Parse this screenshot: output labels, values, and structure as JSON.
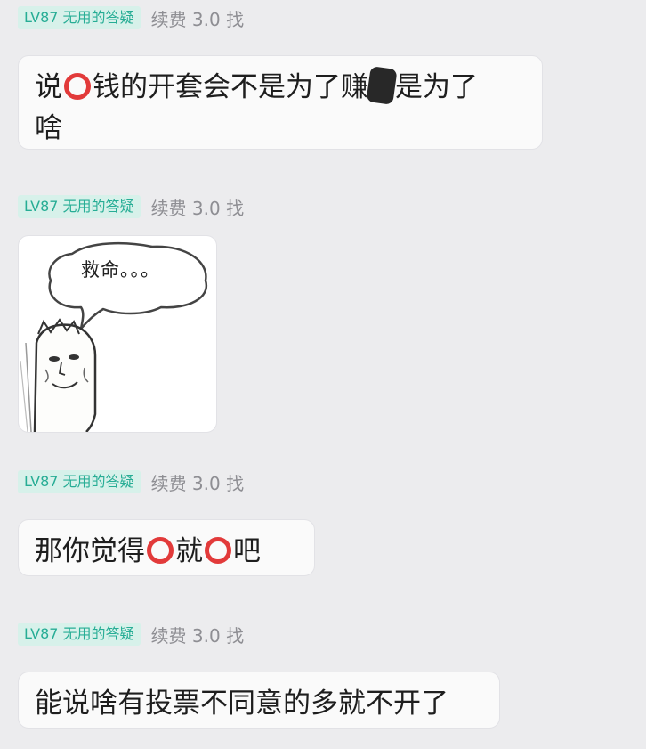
{
  "messages": [
    {
      "badge": "LV87 无用的答疑",
      "nick": "续费 3.0 找",
      "segments": [
        "说",
        "钱的开套会不是为了赚",
        "是为了",
        "啥"
      ]
    },
    {
      "badge": "LV87 无用的答疑",
      "nick": "续费 3.0 找",
      "image_caption": "救命。。。"
    },
    {
      "badge": "LV87 无用的答疑",
      "nick": "续费 3.0 找",
      "segments": [
        "那你觉得",
        "就",
        "吧"
      ]
    },
    {
      "badge": "LV87 无用的答疑",
      "nick": "续费 3.0 找",
      "text": "能说啥有投票不同意的多就不开了"
    }
  ],
  "icons": {
    "redacted_circle": "red-circle-icon",
    "redacted_smudge": "black-smudge"
  },
  "colors": {
    "background": "#ececee",
    "bubble": "#fafafa",
    "badge_bg": "#d7f1ea",
    "badge_text": "#27ad95",
    "nick_text": "#8e8e93",
    "circle": "#e23a3a"
  }
}
